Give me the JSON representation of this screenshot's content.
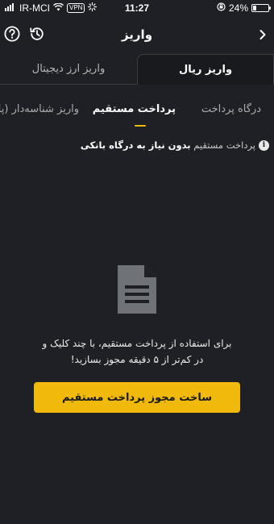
{
  "status_bar": {
    "carrier": "IR-MCI",
    "vpn_label": "VPN",
    "time": "11:27",
    "battery_percent_label": "24%",
    "battery_level": 0.24
  },
  "header": {
    "title": "واریز"
  },
  "top_tabs": [
    {
      "label": "واریز ریال",
      "active": true
    },
    {
      "label": "واریز ارز دیجیتال",
      "active": false
    }
  ],
  "sub_tabs": [
    {
      "label": "درگاه پرداخت",
      "active": false
    },
    {
      "label": "پرداخت مستقیم",
      "active": true
    },
    {
      "label": "واریز شناسه‌دار (پا",
      "active": false
    }
  ],
  "info": {
    "icon_letter": "i",
    "text_regular": "پرداخت مستقیم",
    "text_bold": "بدون نیاز به درگاه بانکی"
  },
  "empty_state": {
    "icon": "document-icon",
    "line1": "برای استفاده از پرداخت مستقیم، با چند کلیک و",
    "line2": "در کم‌تر از ۵ دقیقه مجوز بسازید!"
  },
  "cta": {
    "label": "ساخت مجوز پرداخت مستقیم"
  },
  "colors": {
    "background": "#1e2025",
    "accent": "#f0b90b",
    "icon_gray": "#6f7377"
  }
}
